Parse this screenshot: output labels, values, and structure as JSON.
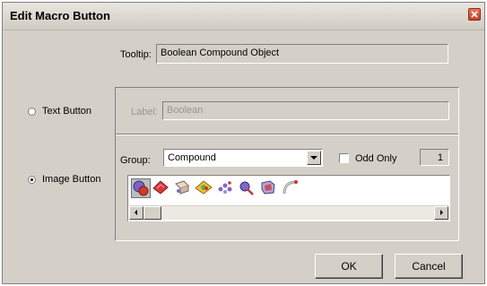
{
  "window": {
    "title": "Edit Macro Button"
  },
  "tooltip": {
    "label": "Tooltip:",
    "value": "Boolean Compound Object"
  },
  "options": {
    "text_button": "Text Button",
    "image_button": "Image Button",
    "selected": "Image Button"
  },
  "label_field": {
    "label": "Label:",
    "value": "Boolean"
  },
  "group": {
    "label": "Group:",
    "value": "Compound"
  },
  "odd_only": {
    "label": "Odd Only",
    "checked": false,
    "count": "1"
  },
  "icons": [
    {
      "name": "boolean-icon",
      "selected": true
    },
    {
      "name": "morph-icon"
    },
    {
      "name": "scatter-icon"
    },
    {
      "name": "conform-icon"
    },
    {
      "name": "connect-icon"
    },
    {
      "name": "shapemerge-icon"
    },
    {
      "name": "terrain-icon"
    },
    {
      "name": "loft-icon"
    }
  ],
  "buttons": {
    "ok": "OK",
    "cancel": "Cancel"
  }
}
